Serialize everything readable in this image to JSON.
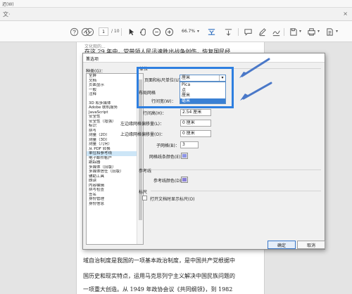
{
  "app": {
    "menu_label": "迟(W)",
    "tab_label": "文·",
    "close_symbol": "×"
  },
  "toolbar": {
    "page_current": "1",
    "page_total": "/ 10",
    "zoom": "66.7%",
    "icons": [
      "help-icon",
      "page-up-icon",
      "page-down-icon",
      "select-arrow-icon",
      "hand-icon",
      "zoom-out-icon",
      "zoom-in-icon",
      "fit-width-icon",
      "scroll-icon",
      "comment-icon",
      "pen-icon",
      "sign-icon",
      "save-icon",
      "print-icon"
    ]
  },
  "document": {
    "top_fragment": "文化观的...",
    "line_top": "在这 29 年中，党带领人民迅速胜出战争创伤，恢复国民经",
    "lines_bottom": [
      "域自治制度是我国的一项基本政治制度，是中国共产党根据中",
      "国历史和现实特点，运用马克思列宁主义解决中国民族问题的",
      "一项重大创造。从 1949 年政协会议《共同纲领》，到 1982"
    ]
  },
  "dialog": {
    "title": "首选项",
    "close": "×",
    "categories_label": "种类(G)：",
    "categories_group1": [
      "全屏",
      "文档",
      "页面显示",
      "一般",
      "注释"
    ],
    "categories_group2": [
      "3D 和多媒体",
      "Adobe 联机服务",
      "JavaScript",
      "安全性",
      "安全性（增强）",
      "标识",
      "拼写",
      "测量（2D）",
      "测量（3D）",
      "测量（几何）",
      "从 PDF 转换",
      "单位和参考线",
      "电子邮件帐户",
      "跟踪器",
      "多媒体（旧版）",
      "多媒体信任（旧版）",
      "辅助工具",
      "朗读",
      "内容编辑",
      "拼写检查",
      "签名",
      "身份管理",
      "身份信息"
    ],
    "selected_category": "单位和参考线",
    "section_units": "单位",
    "page_units_label": "页面和标尺单位(U)：",
    "page_units_value": "厘米",
    "units_options": [
      "Pica",
      "点",
      "厘米",
      "毫米"
    ],
    "units_highlighted": "毫米",
    "layout_grid_section": "布局网格",
    "grid_width_label": "行间宽(W)：",
    "grid_width_value": "",
    "grid_height_label": "行间高(H)：",
    "grid_height_value": "2.54 厘米",
    "left_offset_label": "左边缘网格偏移量(L)：",
    "left_offset_value": "0 厘米",
    "top_offset_label": "上边缘网格偏移量(O)：",
    "top_offset_value": "0 厘米",
    "subdivisions_label": "子网格(B)：",
    "subdivisions_value": "3",
    "grid_color_label": "网格线条颜色(E)：",
    "grid_color": "#8f96e6",
    "guides_section": "参考线",
    "guide_color_label": "参考线颜色(D)：",
    "guide_color": "#8a7fd8",
    "ruler_section": "标尺",
    "ruler_checkbox_label": "打开文档时显示标尺(O)",
    "ok_label": "确定",
    "cancel_label": "取消"
  },
  "colors": {
    "highlight_frame": "#2e7fe0",
    "arrow": "#4a78c8",
    "list_selection": "#cde6f7",
    "option_highlight": "#3a80d4"
  }
}
